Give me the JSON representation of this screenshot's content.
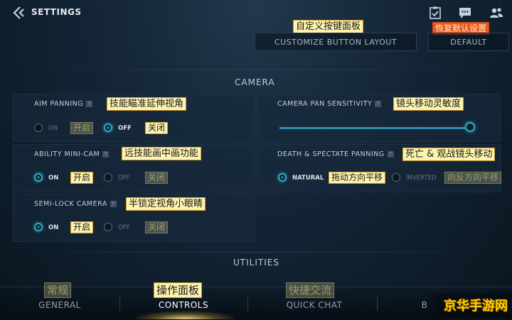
{
  "header": {
    "title": "SETTINGS",
    "icons": [
      "back-arrow-icon",
      "checklist-icon",
      "chat-icon",
      "friends-icon"
    ]
  },
  "top_buttons": {
    "customize_label": "CUSTOMIZE BUTTON LAYOUT",
    "customize_zh": "自定义按键面板",
    "default_label": "DEFAULT",
    "default_zh": "恢复默认设置"
  },
  "camera": {
    "section_title": "CAMERA",
    "aim_panning": {
      "label": "AIM PANNING",
      "zh": "技能瞄准延伸视角",
      "on": "ON",
      "on_zh": "开启",
      "off": "OFF",
      "off_zh": "关闭",
      "selected": "off"
    },
    "camera_pan_sensitivity": {
      "label": "CAMERA PAN SENSITIVITY",
      "zh": "镜头移动灵敏度",
      "value_fraction": 1.0
    },
    "ability_mini_cam": {
      "label": "ABILITY MINI-CAM",
      "zh": "远技能画中画功能",
      "on": "ON",
      "on_zh": "开启",
      "off": "OFF",
      "off_zh": "关闭",
      "selected": "on"
    },
    "death_spectate_panning": {
      "label": "DEATH & SPECTATE PANNING",
      "zh": "死亡 & 观战镜头移动",
      "natural": "NATURAL",
      "natural_zh": "拖动方向平移",
      "inverted": "INVERTED",
      "inverted_zh": "向反方向平移",
      "selected": "natural"
    },
    "semi_lock_camera": {
      "label": "SEMI-LOCK CAMERA",
      "zh": "半锁定视角小眼睛",
      "on": "ON",
      "on_zh": "开启",
      "off": "OFF",
      "off_zh": "关闭",
      "selected": "on"
    }
  },
  "utilities": {
    "section_title": "UTILITIES"
  },
  "tabs": [
    {
      "label": "GENERAL",
      "zh": "常规"
    },
    {
      "label": "CONTROLS",
      "zh": "操作面板"
    },
    {
      "label": "QUICK CHAT",
      "zh": "快捷交流"
    },
    {
      "label": "B",
      "zh": ""
    }
  ],
  "watermark": "京华手游网"
}
